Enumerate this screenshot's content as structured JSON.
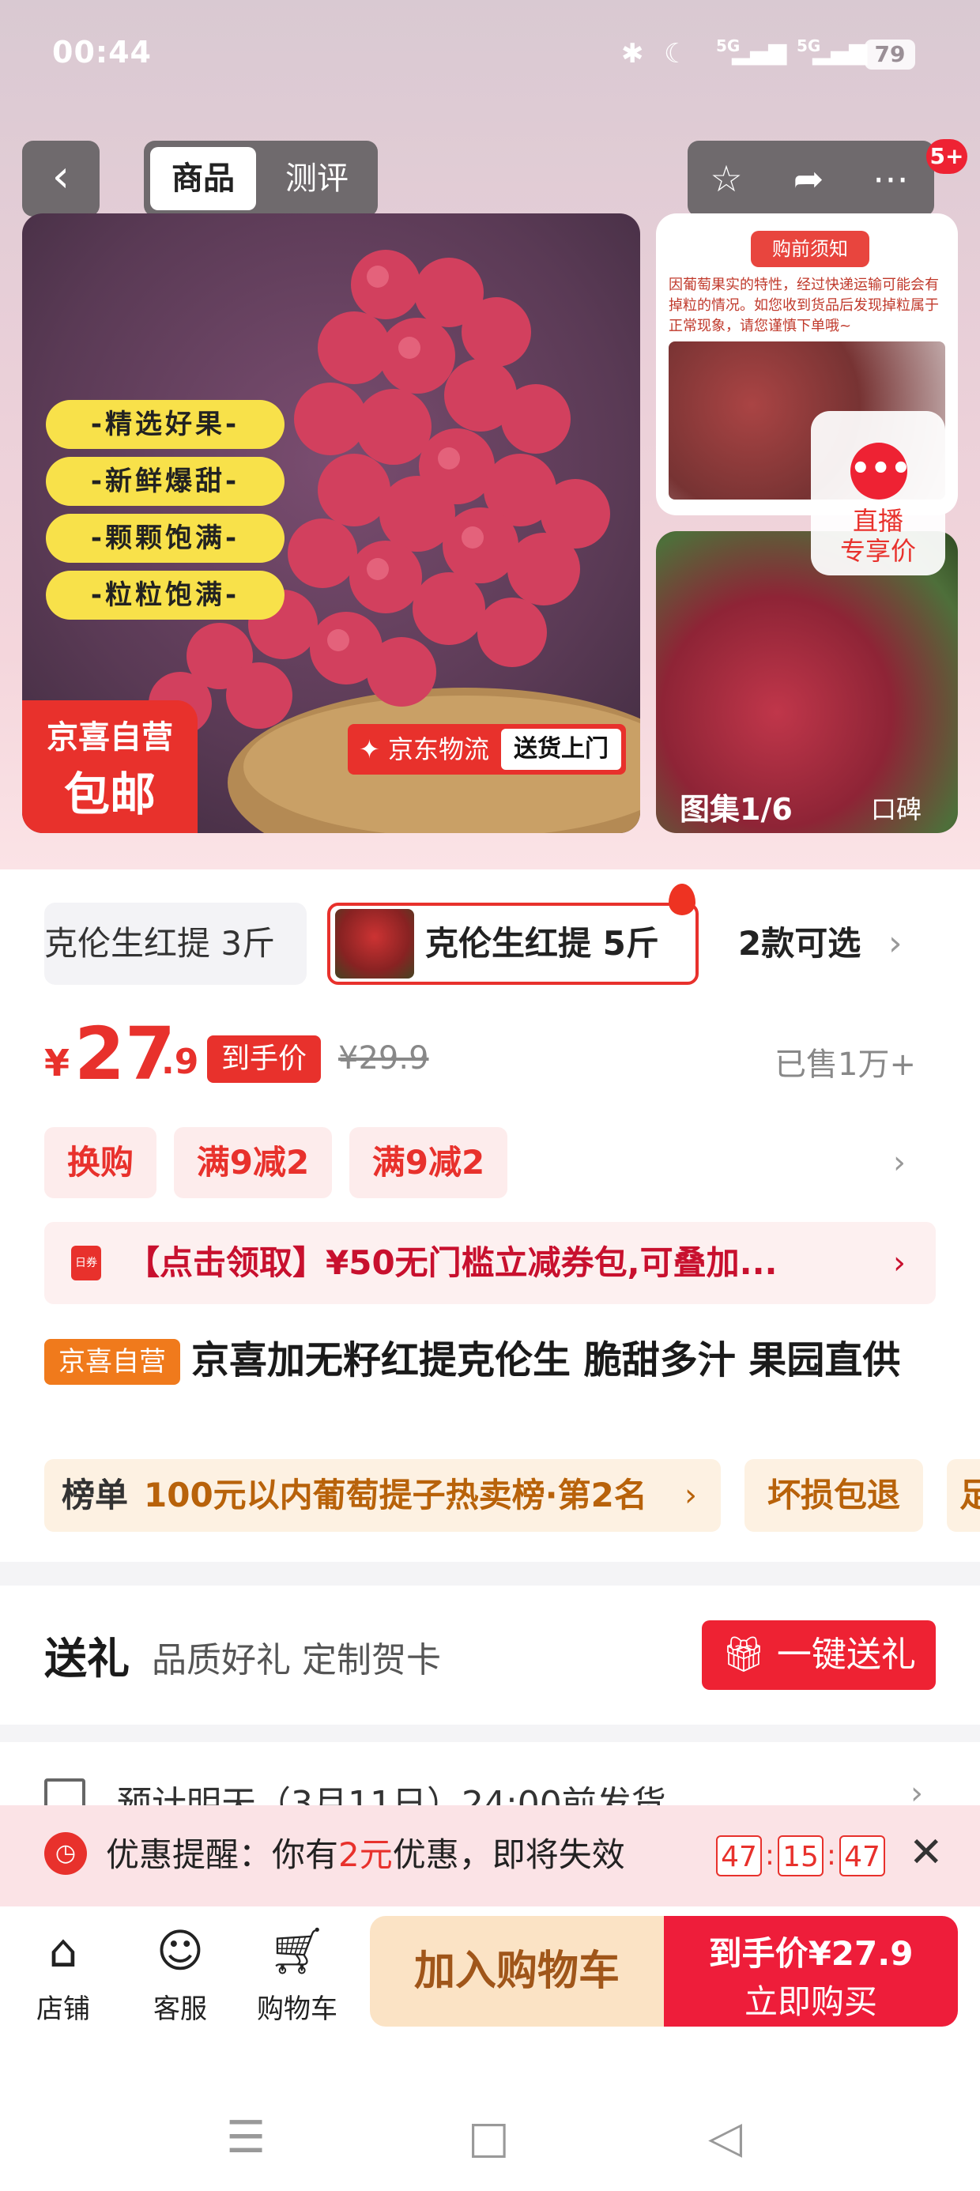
{
  "status_bar": {
    "time": "00:44",
    "icons": [
      "bluetooth-icon",
      "moon-icon",
      "signal-5g-icon",
      "signal-5g-icon"
    ],
    "signal_label_1": "5G",
    "signal_label_2": "5G",
    "battery": "79"
  },
  "nav": {
    "tabs": [
      "商品",
      "测评"
    ],
    "active_tab": "商品",
    "message_badge": "5+"
  },
  "hero": {
    "feature_pills": [
      "-精选好果-",
      "-新鲜爆甜-",
      "-颗颗饱满-",
      "-粒粒饱满-"
    ],
    "self_operated_line1": "京喜自营",
    "self_operated_line2": "包邮",
    "logistics_label": "京东物流",
    "logistics_door": "送货上门",
    "notice_title": "购前须知",
    "notice_text": "因葡萄果实的特性，经过快递运输可能会有掉粒的情况。如您收到货品后发现掉粒属于正常现象，请您谨慎下单哦~",
    "gallery_label": "图集1/6",
    "review_label": "口碑",
    "live_label_line1": "直播",
    "live_label_line2": "专享价"
  },
  "variants": {
    "option1": "克伦生红提 3斤",
    "option2": "克伦生红提 5斤",
    "more": "2款可选"
  },
  "price": {
    "currency": "¥",
    "integer": "27",
    "decimal": ".9",
    "tag": "到手价",
    "original": "¥29.9",
    "sold": "已售1万+"
  },
  "promos": [
    "换购",
    "满9减2",
    "满9减2"
  ],
  "coupon": {
    "icon_text": "日券",
    "text": "【点击领取】¥50无门槛立减券包,可叠加..."
  },
  "product": {
    "tag": "京喜自营",
    "title": "京喜加无籽红提克伦生 脆甜多汁 果园直供"
  },
  "ranking": {
    "label": "榜单",
    "text": "100元以内葡萄提子热卖榜·第2名",
    "chip_damage": "坏损包退",
    "chip_cut": "足"
  },
  "gift": {
    "title": "送礼",
    "subtitle": "品质好礼 定制贺卡",
    "button": "一键送礼"
  },
  "shipping": {
    "text": "预计明天（3月11日）24:00前发货"
  },
  "reminder": {
    "prefix": "优惠提醒：你有",
    "amount": "2元",
    "suffix": "优惠，即将失效",
    "timer": [
      "47",
      "15",
      "47"
    ]
  },
  "bottom_bar": {
    "shop": "店铺",
    "service": "客服",
    "cart": "购物车",
    "add_to_cart": "加入购物车",
    "buy_price": "到手价¥27.9",
    "buy_now": "立即购买"
  },
  "colors": {
    "accent_red": "#e8312c",
    "orange_tag": "#f07a1c",
    "pill_yellow": "#f8e14a"
  }
}
